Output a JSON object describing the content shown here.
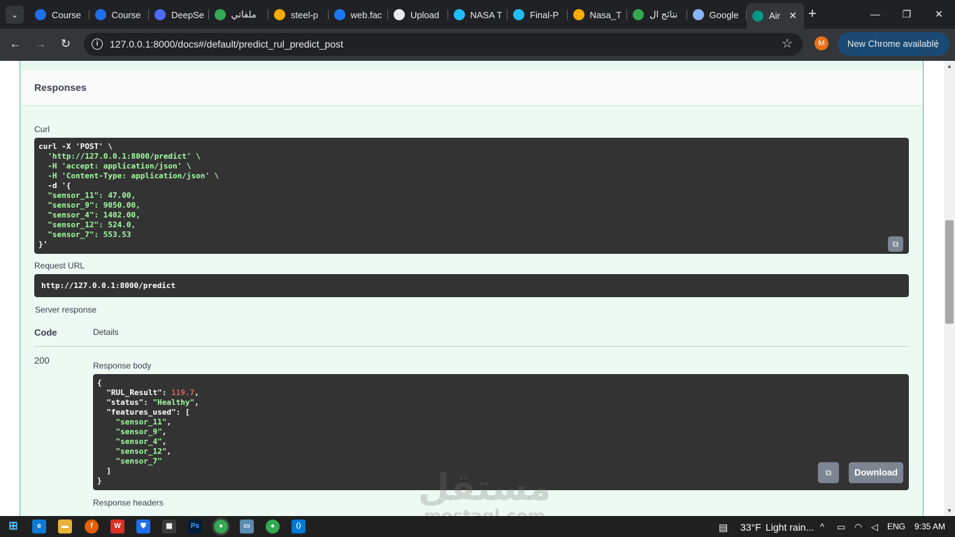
{
  "browser": {
    "tabs": [
      {
        "title": "Course",
        "favicon": "coursera-icon",
        "color": "#1f6feb"
      },
      {
        "title": "Course",
        "favicon": "coursera-icon",
        "color": "#1f6feb"
      },
      {
        "title": "DeepSe",
        "favicon": "deepseek-icon",
        "color": "#4d6bfe"
      },
      {
        "title": "ملفاتي",
        "favicon": "drive-icon",
        "color": "#34a853"
      },
      {
        "title": "steel-p",
        "favicon": "colab-icon",
        "color": "#f9ab00"
      },
      {
        "title": "web.fac",
        "favicon": "facebook-icon",
        "color": "#1877f2"
      },
      {
        "title": "Upload",
        "favicon": "github-icon",
        "color": "#e8eaed"
      },
      {
        "title": "NASA T",
        "favicon": "kaggle-icon",
        "color": "#20beff"
      },
      {
        "title": "Final-P",
        "favicon": "kaggle-icon",
        "color": "#20beff"
      },
      {
        "title": "Nasa_T",
        "favicon": "colab-icon",
        "color": "#f9ab00"
      },
      {
        "title": "نتائج ال",
        "favicon": "drive-icon",
        "color": "#34a853"
      },
      {
        "title": "Google",
        "favicon": "gemini-icon",
        "color": "#8ab4f8"
      },
      {
        "title": "Air",
        "favicon": "fastapi-icon",
        "color": "#009688"
      }
    ],
    "url": "127.0.0.1:8000/docs#/default/predict_rul_predict_post",
    "avatar_letter": "M",
    "update_label": "New Chrome available"
  },
  "page": {
    "responses_heading": "Responses",
    "curl_label": "Curl",
    "curl_lines": [
      "curl -X 'POST' \\",
      "  'http://127.0.0.1:8000/predict' \\",
      "  -H 'accept: application/json' \\",
      "  -H 'Content-Type: application/json' \\",
      "  -d '{",
      "  \"sensor_11\": 47.00,",
      "  \"sensor_9\": 9050.00,",
      "  \"sensor_4\": 1402.00,",
      "  \"sensor_12\": 524.0,",
      "  \"sensor_7\": 553.53",
      "}'"
    ],
    "request_url_label": "Request URL",
    "request_url": "http://127.0.0.1:8000/predict",
    "server_response_label": "Server response",
    "code_header": "Code",
    "details_header": "Details",
    "status_code": "200",
    "response_body_label": "Response body",
    "response_body": {
      "rul_key": "\"RUL_Result\"",
      "rul_value": "119.7",
      "status_key": "\"status\"",
      "status_value": "\"Healthy\"",
      "features_key": "\"features_used\"",
      "features": [
        "\"sensor_11\"",
        "\"sensor_9\"",
        "\"sensor_4\"",
        "\"sensor_12\"",
        "\"sensor_7\""
      ]
    },
    "download_label": "Download",
    "response_headers_label": "Response headers"
  },
  "watermark": {
    "arabic": "مستقل",
    "latin": "mostaql.com"
  },
  "taskbar": {
    "weather_temp": "33°F",
    "weather_text": "Light rain...",
    "language": "ENG",
    "time": "9:35 AM"
  }
}
